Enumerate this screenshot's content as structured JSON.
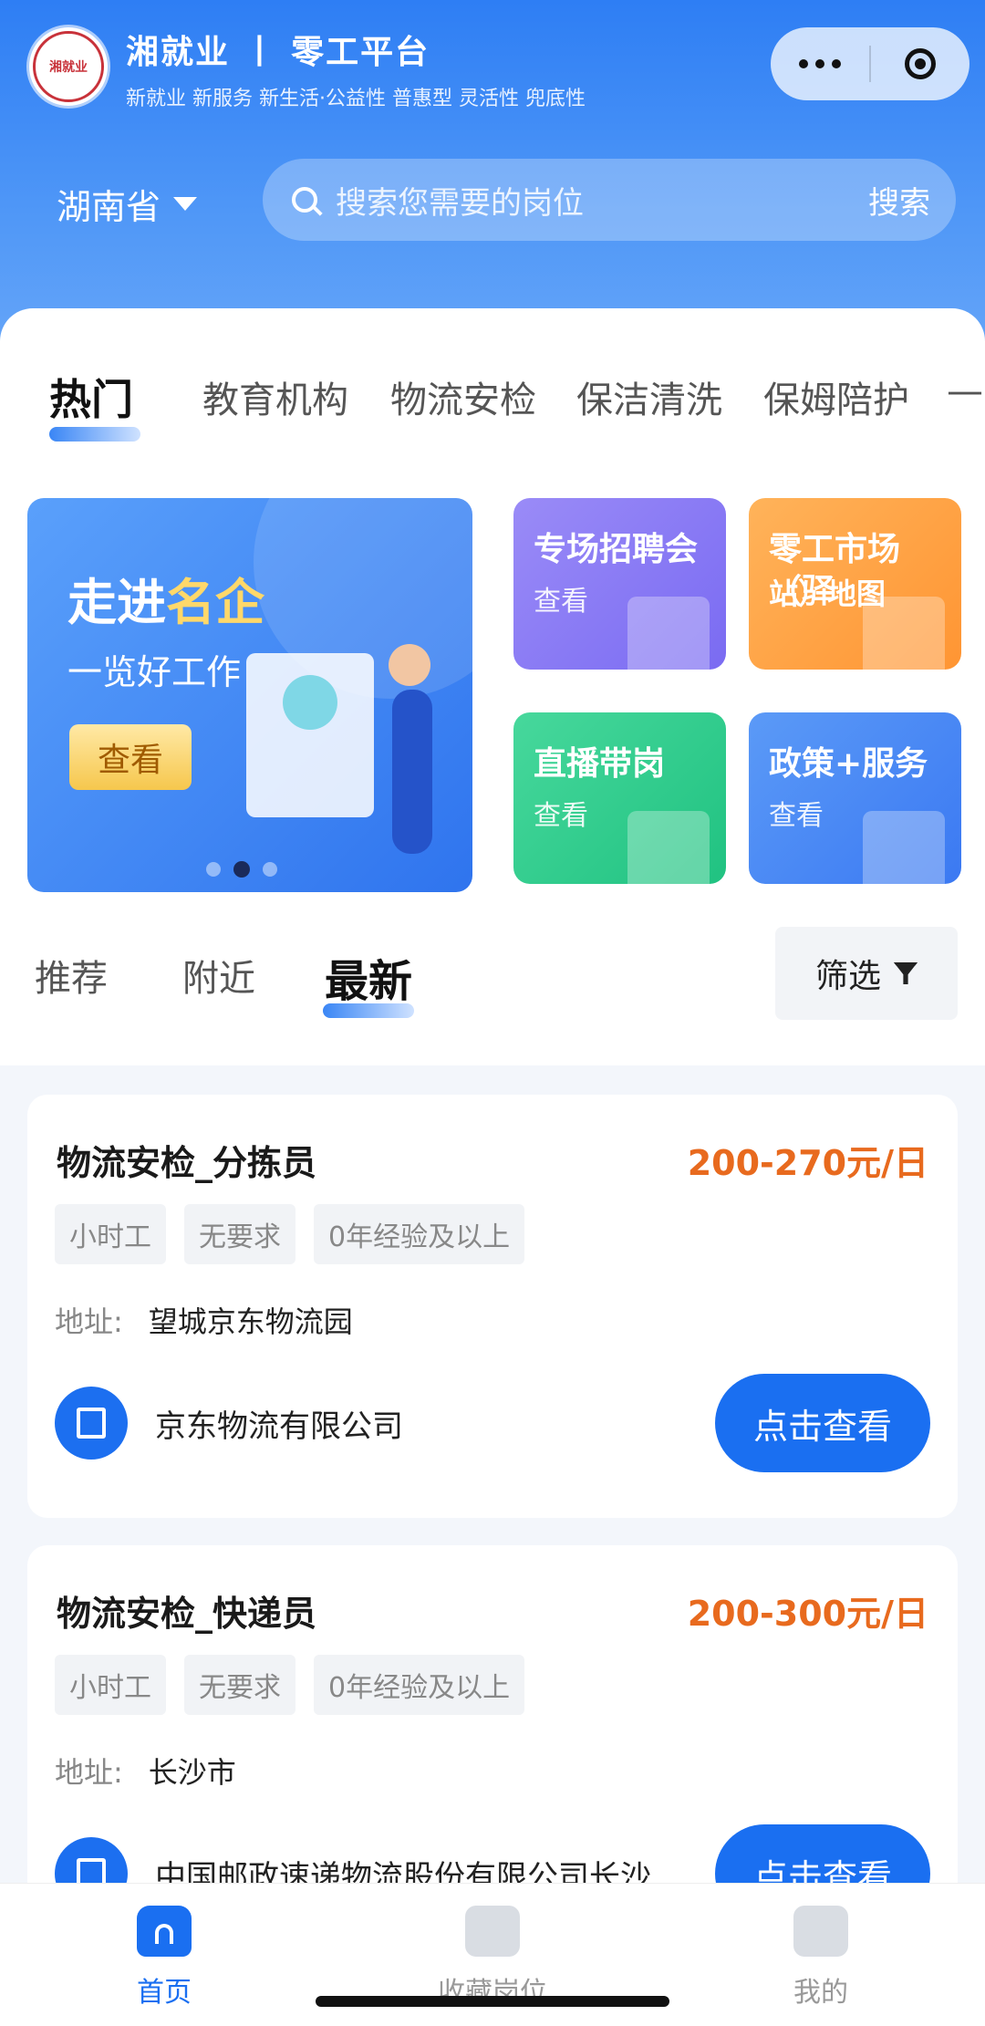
{
  "header": {
    "logo_text": "湘就业",
    "title": "湘就业 丨 零工平台",
    "subtitle": "新就业 新服务 新生活·公益性 普惠型 灵活性 兜底性",
    "province": "湖南省",
    "search": {
      "placeholder": "搜索您需要的岗位",
      "button": "搜索"
    }
  },
  "category_tabs": [
    "热门",
    "教育机构",
    "物流安检",
    "保洁清洗",
    "保姆陪护",
    "—"
  ],
  "banner": {
    "title_part1": "走进",
    "title_part2": "名企",
    "subtitle": "一览好工作",
    "button": "查看",
    "active_dot": 1
  },
  "tiles": [
    {
      "title": "专场招聘会",
      "link": "查看"
    },
    {
      "title": "零工市场（驿",
      "link": "站）地图"
    },
    {
      "title": "直播带岗",
      "link": "查看"
    },
    {
      "title": "政策+服务",
      "link": "查看"
    }
  ],
  "list_tabs": {
    "tabs": [
      "推荐",
      "附近",
      "最新"
    ],
    "active": "最新",
    "filter": "筛选"
  },
  "jobs": [
    {
      "title": "物流安检_分拣员",
      "salary": "200-270元/日",
      "tags": [
        "小时工",
        "无要求",
        "0年经验及以上"
      ],
      "address_label": "地址:",
      "address": "望城京东物流园",
      "company": "京东物流有限公司",
      "button": "点击查看"
    },
    {
      "title": "物流安检_快递员",
      "salary": "200-300元/日",
      "tags": [
        "小时工",
        "无要求",
        "0年经验及以上"
      ],
      "address_label": "地址:",
      "address": "长沙市",
      "company": "中国邮政速递物流股份有限公司长沙...",
      "button": "点击查看"
    }
  ],
  "tabbar": [
    "首页",
    "收藏岗位",
    "我的"
  ],
  "colors": {
    "primary": "#1a6ff1",
    "salary": "#e86a1e",
    "header": "#2e7ef4"
  }
}
